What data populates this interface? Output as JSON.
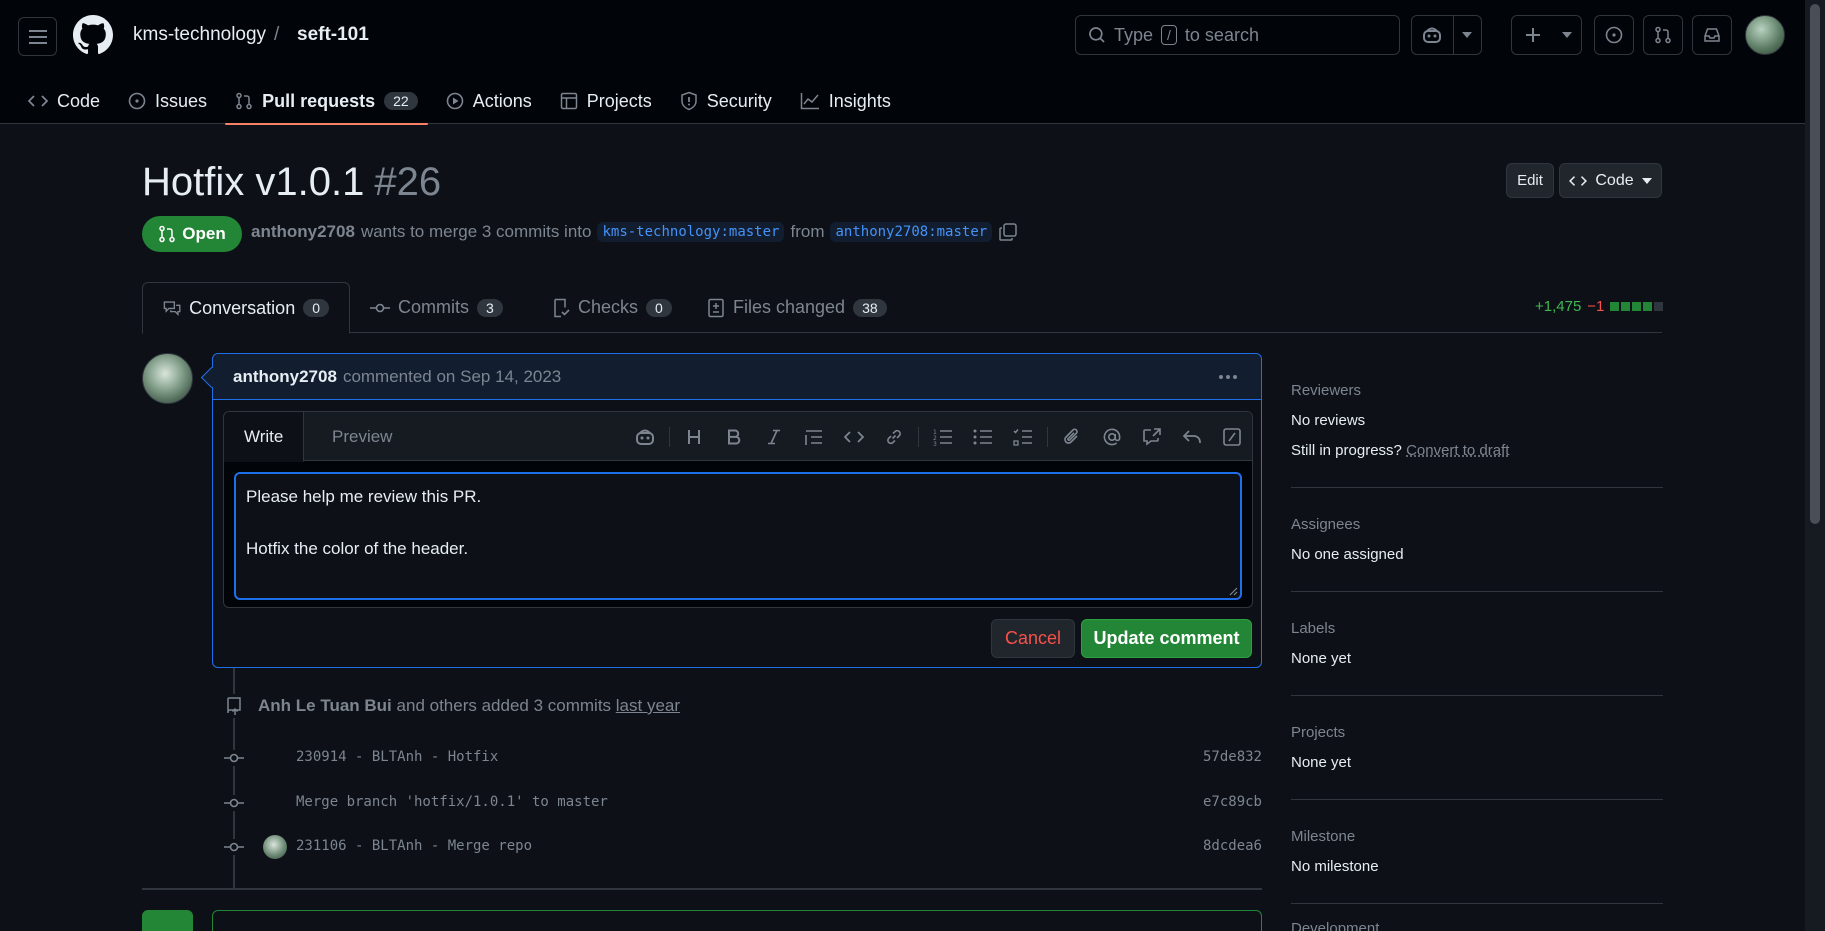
{
  "header": {
    "owner": "kms-technology",
    "separator": "/",
    "repo": "seft-101",
    "search_prefix": "Type",
    "search_key": "/",
    "search_suffix": "to search"
  },
  "nav": {
    "tabs": [
      {
        "label": "Code"
      },
      {
        "label": "Issues"
      },
      {
        "label": "Pull requests",
        "count": "22"
      },
      {
        "label": "Actions"
      },
      {
        "label": "Projects"
      },
      {
        "label": "Security"
      },
      {
        "label": "Insights"
      }
    ]
  },
  "pr": {
    "title": "Hotfix v1.0.1",
    "number": "#26",
    "state": "Open",
    "author": "anthony2708",
    "merge_text": "wants to merge 3 commits into",
    "base_branch": "kms-technology:master",
    "from_text": "from",
    "head_branch": "anthony2708:master",
    "edit_label": "Edit",
    "code_label": "Code"
  },
  "pr_tabs": [
    {
      "label": "Conversation",
      "count": "0"
    },
    {
      "label": "Commits",
      "count": "3"
    },
    {
      "label": "Checks",
      "count": "0"
    },
    {
      "label": "Files changed",
      "count": "38"
    }
  ],
  "diffstat": {
    "additions": "+1,475",
    "deletions": "−1"
  },
  "comment": {
    "author": "anthony2708",
    "meta": "commented on Sep 14, 2023",
    "write_tab": "Write",
    "preview_tab": "Preview",
    "body_line1": "Please help me review this PR.",
    "body_line2": "Hotfix the color of the header.",
    "cancel_label": "Cancel",
    "update_label": "Update comment"
  },
  "timeline": {
    "event_author": "Anh Le Tuan Bui",
    "event_text": "and others added 3 commits",
    "event_time": "last year",
    "commits": [
      {
        "message": "230914 - BLTAnh - Hotfix",
        "sha": "57de832"
      },
      {
        "message": "Merge branch 'hotfix/1.0.1' to master",
        "sha": "e7c89cb"
      },
      {
        "message": "231106 - BLTAnh - Merge repo",
        "sha": "8dcdea6"
      }
    ]
  },
  "sidebar": {
    "reviewers_title": "Reviewers",
    "reviewers_value": "No reviews",
    "in_progress_text": "Still in progress?",
    "convert_link": "Convert to draft",
    "assignees_title": "Assignees",
    "assignees_value": "No one assigned",
    "labels_title": "Labels",
    "labels_value": "None yet",
    "projects_title": "Projects",
    "projects_value": "None yet",
    "milestone_title": "Milestone",
    "milestone_value": "No milestone",
    "development_title": "Development"
  },
  "colors": {
    "accent_open": "#238636",
    "link_blue": "#4493f8",
    "focus_border": "#1f6feb",
    "danger": "#f85149",
    "tab_underline": "#f78166"
  }
}
